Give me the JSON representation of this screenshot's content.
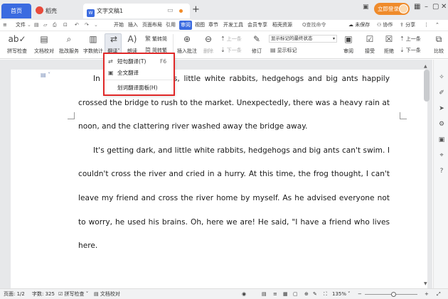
{
  "titlebar": {
    "home_tab": "首页",
    "daoke_tab": "稻壳",
    "doc_tab": "文字文稿1",
    "doc_badge": "W",
    "new_tab": "+",
    "login": "立即登录",
    "icons": [
      "window-layout-icon",
      "grid-icon",
      "minimize-icon",
      "maximize-icon",
      "close-icon"
    ]
  },
  "menubar": {
    "file": "文件",
    "items": [
      "开始",
      "插入",
      "页面布局",
      "引用",
      "审阅",
      "视图",
      "章节",
      "开发工具",
      "会员专享",
      "稻壳资源"
    ],
    "active": "审阅",
    "search": "Q查找命令",
    "unsaved": "未保存",
    "collab": "协作",
    "share": "分享"
  },
  "ribbon": {
    "spellcheck": "拼写检查",
    "doc_check": "文档校对",
    "revise_service": "批改服务",
    "word_count": "字数统计",
    "translate": "翻译",
    "read_aloud": "朗读",
    "simp_trad": "繁转简",
    "trad_simp": "简转繁",
    "insert_comment": "插入批注",
    "delete": "删除",
    "prev_comment": "上一条",
    "next_comment": "下一条",
    "revise": "修订",
    "markup_state": "显示标记的最终状态",
    "show_markup": "显示标记",
    "review": "审阅",
    "accept": "接受",
    "reject": "拒绝",
    "prev_change": "上一条",
    "next_change": "下一条",
    "compare": "比较"
  },
  "dropdown": {
    "items": [
      {
        "label": "短句翻译(T)",
        "shortcut": "F6"
      },
      {
        "label": "全文翻译",
        "shortcut": ""
      },
      {
        "label": "划词翻译面板(H)",
        "shortcut": ""
      }
    ]
  },
  "document": {
    "paragraphs": [
      "In the morning, frogs, little white rabbits, hedgehogs and big ants happily crossed the bridge to rush to the market. Unexpectedly, there was a heavy rain at noon, and the clattering river washed away the bridge away.",
      "It's getting dark, and little white rabbits, hedgehogs and big ants can't swim. I couldn't cross the river and cried in a hurry. At this time, the frog thought, I can't leave my friend and cross the river home by myself. As he advised everyone not to worry, he used his brains. Oh, here we are! He said, \"I have a friend who lives here."
    ]
  },
  "statusbar": {
    "page": "页面: 1/2",
    "word_count": "字数: 325",
    "spellcheck": "拼写检查",
    "doc_check": "文档校对",
    "zoom": "135%",
    "zoom_level": 1.35
  },
  "colors": {
    "accent": "#3b6be0",
    "login": "#ef8b2b",
    "highlight_outline": "#e02828"
  }
}
